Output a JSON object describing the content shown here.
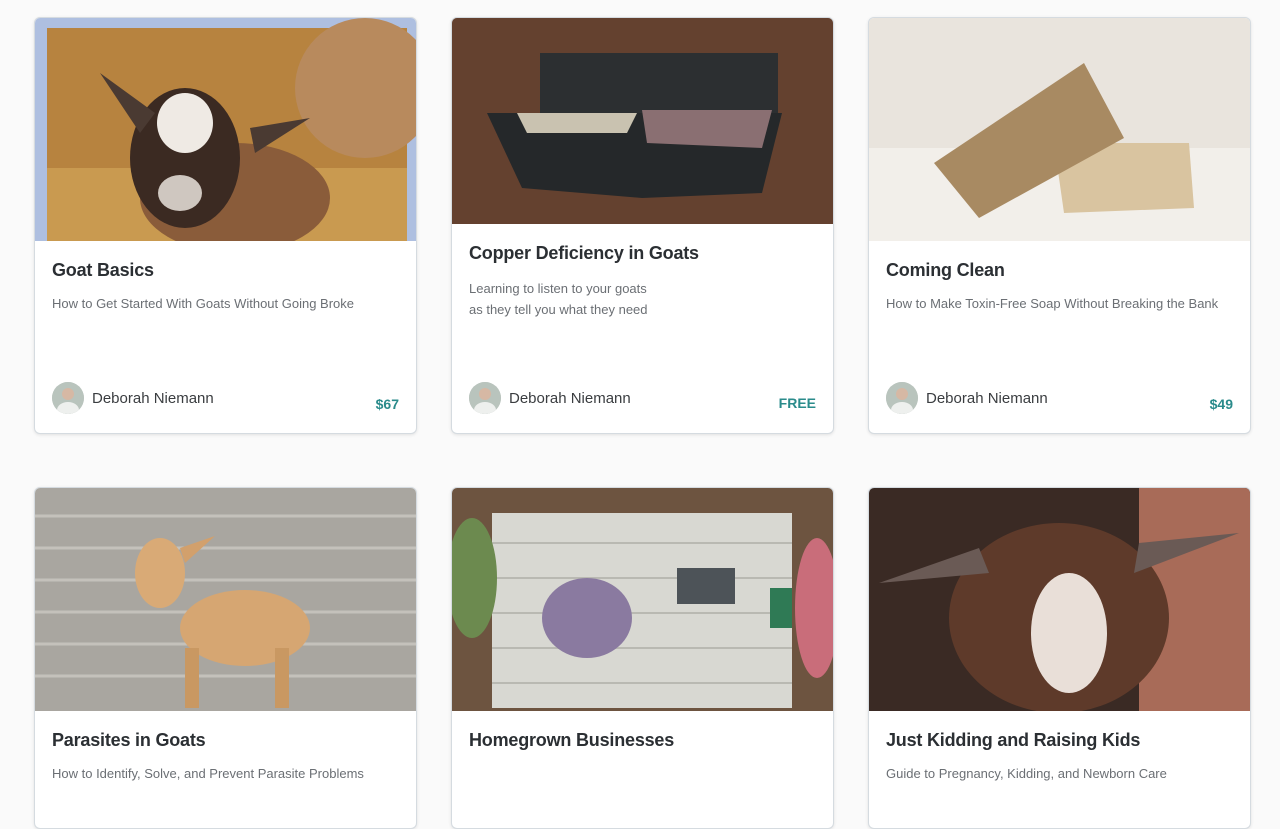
{
  "courses": [
    {
      "title": "Goat Basics",
      "subtitle": [
        "How to Get Started With Goats Without Going Broke"
      ],
      "author": "Deborah Niemann",
      "price": "$67",
      "image": "brown and white baby goat in straw"
    },
    {
      "title": "Copper Deficiency in Goats",
      "subtitle": [
        "Learning to listen to your goats",
        "as they tell you what they need"
      ],
      "author": "Deborah Niemann",
      "price": "FREE",
      "image": "mineral feeder on barn wall"
    },
    {
      "title": "Coming Clean",
      "subtitle": [
        "How to Make Toxin-Free Soap Without Breaking the Bank"
      ],
      "author": "Deborah Niemann",
      "price": "$49",
      "image": "bars of homemade soap on towel"
    },
    {
      "title": "Parasites in Goats",
      "subtitle": [
        "How to Identify, Solve, and Prevent Parasite Problems"
      ],
      "author": "",
      "price": "",
      "image": "tan goat against grey wall"
    },
    {
      "title": "Homegrown Businesses",
      "subtitle": [],
      "author": "",
      "price": "",
      "image": "flat lay of flowers and laptop on table"
    },
    {
      "title": "Just Kidding and Raising Kids",
      "subtitle": [
        "Guide to Pregnancy, Kidding, and Newborn Care"
      ],
      "author": "",
      "price": "",
      "image": "newborn brown goat kid"
    }
  ],
  "colors": {
    "accent": "#2a8b8b",
    "title": "#2b2f33",
    "subtitle": "#6b6f74"
  }
}
